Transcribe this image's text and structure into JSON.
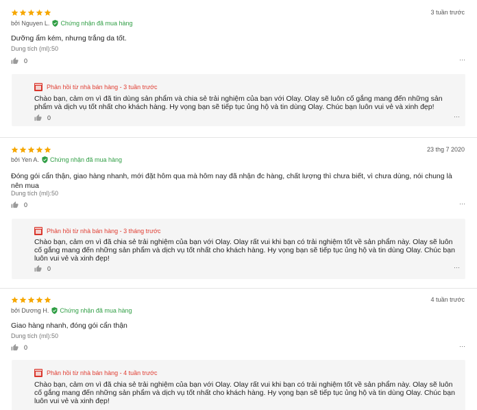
{
  "colors": {
    "star": "#f6a700",
    "verified": "#2f9e44",
    "reply_accent": "#e03c31",
    "reply_bg": "#f5f5f5"
  },
  "icons": {
    "star": "star-icon",
    "verified": "shield-check-icon",
    "like": "thumb-up-icon",
    "shop": "shop-icon",
    "more": "more-dots-icon"
  },
  "reviews": [
    {
      "rating": 5,
      "date": "3 tuần trước",
      "author": "bởi Nguyen L.",
      "verified_label": "Chứng nhận đã mua hàng",
      "text": "Dưỡng ẩm kém, nhưng trắng da tốt.",
      "attribute": "Dung tích (ml):50",
      "likes": "0",
      "more": "⋯",
      "reply": {
        "header": "Phản hồi từ nhà bán hàng - 3 tuần trước",
        "text": "Chào bạn, cảm ơn vì đã tin dùng sản phẩm và chia sẻ trải nghiệm của bạn với Olay. Olay sẽ luôn cố gắng mang đến những sản phẩm và dịch vụ tốt nhất cho khách hàng. Hy vọng bạn sẽ tiếp tục ủng hộ và tin dùng Olay. Chúc bạn luôn vui vẻ và xinh đẹp!",
        "likes": "0",
        "more": "⋯"
      }
    },
    {
      "rating": 5,
      "date": "23 thg 7 2020",
      "author": "bởi Yen A.",
      "verified_label": "Chứng nhận đã mua hàng",
      "text": "Đóng gói cẩn thận, giao hàng nhanh, mới đặt hôm qua mà hôm nay đã nhận đc hàng, chất lượng thì chưa biết, vì chưa dùng, nói chung là nên mua",
      "attribute": "Dung tích (ml):50",
      "likes": "0",
      "more": "⋯",
      "reply": {
        "header": "Phản hồi từ nhà bán hàng - 3 tháng trước",
        "text": "Chào bạn, cảm ơn vì đã chia sẻ trải nghiệm của bạn với Olay. Olay rất vui khi bạn có trải nghiệm tốt về sản phẩm này. Olay sẽ luôn cố gắng mang đến những sản phẩm và dịch vụ tốt nhất cho khách hàng. Hy vọng bạn sẽ tiếp tục ủng hộ và tin dùng Olay. Chúc bạn luôn vui vẻ và xinh đẹp!",
        "likes": "0",
        "more": "⋯"
      }
    },
    {
      "rating": 5,
      "date": "4 tuần trước",
      "author": "bởi Dương H.",
      "verified_label": "Chứng nhận đã mua hàng",
      "text": "Giao hàng nhanh, đóng gói cẩn thận",
      "attribute": "Dung tích (ml):50",
      "likes": "0",
      "more": "⋯",
      "reply": {
        "header": "Phản hồi từ nhà bán hàng - 4 tuần trước",
        "text": "Chào bạn, cảm ơn vì đã chia sẻ trải nghiệm của bạn với Olay. Olay rất vui khi bạn có trải nghiệm tốt về sản phẩm này. Olay sẽ luôn cố gắng mang đến những sản phẩm và dịch vụ tốt nhất cho khách hàng. Hy vọng bạn sẽ tiếp tục ủng hộ và tin dùng Olay. Chúc bạn luôn vui vẻ và xinh đẹp!",
        "likes": "",
        "more": ""
      }
    }
  ]
}
